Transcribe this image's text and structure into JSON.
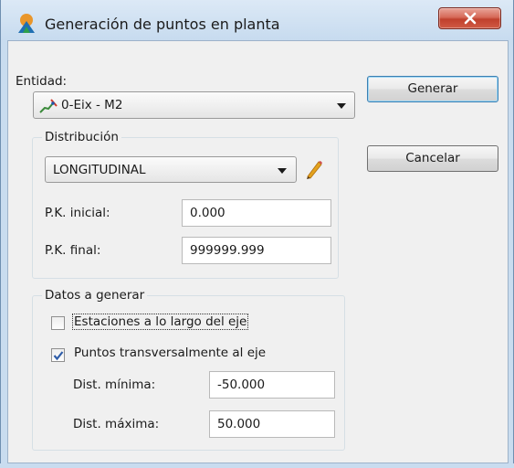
{
  "window": {
    "title": "Generación de puntos en planta",
    "close_glyph": "X",
    "app_icon": "app-logo-icon",
    "colors": {
      "titlebar": "#c7dbef",
      "close_button": "#c0402d",
      "check": "#2f5da8"
    }
  },
  "entidad": {
    "label": "Entidad:",
    "value": "0-Eix - M2",
    "icon": "axis-line-icon"
  },
  "distribucion": {
    "title": "Distribución",
    "value": "LONGITUDINAL",
    "edit_icon": "pencil-icon"
  },
  "pk": {
    "inicial_label": "P.K. inicial:",
    "inicial_value": "0.000",
    "final_label": "P.K. final:",
    "final_value": "999999.999"
  },
  "datos": {
    "title": "Datos a generar",
    "estaciones_label": "Estaciones a lo largo del eje",
    "estaciones_checked": false,
    "puntos_label": "Puntos transversalmente al eje",
    "puntos_checked": true,
    "dist_min_label": "Dist. mínima:",
    "dist_min_value": "-50.000",
    "dist_max_label": "Dist. máxima:",
    "dist_max_value": "50.000"
  },
  "buttons": {
    "generar": "Generar",
    "cancelar": "Cancelar"
  }
}
